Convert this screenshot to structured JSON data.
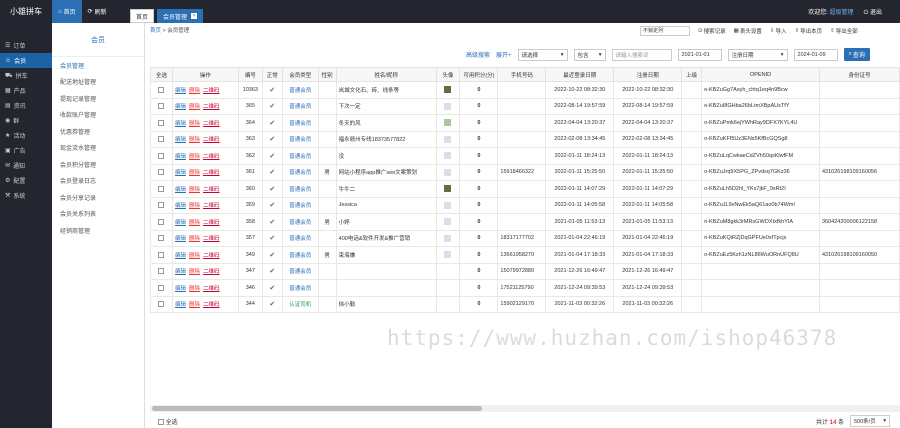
{
  "app": {
    "title": "小雄拼车"
  },
  "topnav": {
    "tabs": [
      {
        "label": "首页",
        "icon": "home-icon"
      },
      {
        "label": "刷新",
        "icon": "refresh-icon"
      }
    ],
    "welcome": "欢迎您:",
    "user": "超级管理",
    "logout": "退出"
  },
  "sidebar": {
    "items": [
      {
        "label": "订单",
        "icon": "order-icon"
      },
      {
        "label": "会员",
        "icon": "user-icon",
        "active": true
      },
      {
        "label": "拼车",
        "icon": "car-icon"
      },
      {
        "label": "产品",
        "icon": "product-icon"
      },
      {
        "label": "资讯",
        "icon": "news-icon"
      },
      {
        "label": "群",
        "icon": "group-icon"
      },
      {
        "label": "活动",
        "icon": "event-icon"
      },
      {
        "label": "广告",
        "icon": "ad-icon"
      },
      {
        "label": "通知",
        "icon": "notice-icon"
      },
      {
        "label": "配置",
        "icon": "config-icon"
      },
      {
        "label": "系统",
        "icon": "system-icon"
      }
    ]
  },
  "window_tabs": [
    {
      "label": "首页"
    },
    {
      "label": "会员管理",
      "active": true
    }
  ],
  "tab_tools": {
    "select": "不锁定列",
    "search_record": "搜索记录",
    "header_settings": "表头设置",
    "import": "导入",
    "export_page": "导出本页",
    "export_all": "导出全部"
  },
  "submenu": {
    "title": "会员",
    "items": [
      "会员管理",
      "配送地址管理",
      "提现记录管理",
      "收款账户管理",
      "优惠券管理",
      "现金流水管理",
      "会员积分管理",
      "会员登录日志",
      "会员分享记录",
      "会员关系列表",
      "经销商管理"
    ]
  },
  "breadcrumb": {
    "home": "首页",
    "sep": " > ",
    "current": "会员管理"
  },
  "filters": {
    "advanced": "高级搜索",
    "expand": "展开+",
    "field_select": "请选择",
    "mode_select": "包含",
    "keyword_placeholder": "请输入搜索词",
    "date_from": "2021-01-01",
    "date_field": "注册日期",
    "date_to": "2024-01-09",
    "search_button": "查询"
  },
  "table": {
    "headers": [
      "全选",
      "操作",
      "编号",
      "正常",
      "会员类型",
      "性别",
      "姓名/昵称",
      "头像",
      "可用积分(分)",
      "手机号码",
      "最近登录日期",
      "注册日期",
      "上级",
      "OPENID",
      "身份证号"
    ],
    "ops": [
      "编辑",
      "删除",
      "二维码"
    ],
    "rows": [
      {
        "id": "10363",
        "type": "普通会员",
        "gender": "",
        "name": "岚城文化石、砖、线条等",
        "avatar": "dark",
        "points": "0",
        "phone": "",
        "last_login": "2022-10-22 08:32:30",
        "reg": "2022-10-22 08:32:30",
        "parent": "",
        "openid": "o-KBZuGg7Asyh_chtq1eq4n9Bcw",
        "idcard": ""
      },
      {
        "id": "365",
        "type": "普通会员",
        "gender": "",
        "name": "下次一定",
        "avatar": "light",
        "points": "0",
        "phone": "",
        "last_login": "2022-08-14 19:57:59",
        "reg": "2022-08-14 19:57:59",
        "parent": "",
        "openid": "o-KBZuI8GHba26bLtmXBpAUsTfY",
        "idcard": ""
      },
      {
        "id": "364",
        "type": "普通会员",
        "gender": "",
        "name": "冬天的风",
        "avatar": "img",
        "points": "0",
        "phone": "",
        "last_login": "2022-04-04 13:20:37",
        "reg": "2022-04-04 13:20:37",
        "parent": "",
        "openid": "o-KBZuPmk6ejYWhRay9DFX7KYL4U",
        "idcard": ""
      },
      {
        "id": "363",
        "type": "普通会员",
        "gender": "",
        "name": "福永赣州专线18373577822",
        "avatar": "light",
        "points": "0",
        "phone": "",
        "last_login": "2022-02-08 13:34:45",
        "reg": "2022-02-08 13:34:45",
        "parent": "",
        "openid": "o-KBZuKFf5Uz3ENs5KfBcGQSg8",
        "idcard": ""
      },
      {
        "id": "362",
        "type": "普通会员",
        "gender": "",
        "name": "没",
        "avatar": "light",
        "points": "0",
        "phone": "",
        "last_login": "2022-01-11 18:24:13",
        "reg": "2022-01-11 18:24:13",
        "parent": "",
        "openid": "o-KBZuLqCwkaeCdZVh50qsKlwfFM",
        "idcard": ""
      },
      {
        "id": "361",
        "type": "普通会员",
        "gender": "男",
        "name": "网站小程序app推广seo文案策划",
        "avatar": "light",
        "points": "0",
        "phone": "15918466322",
        "last_login": "2022-01-11 15:25:50",
        "reg": "2022-01-11 15:25:50",
        "parent": "",
        "openid": "o-KBZuJrq9X5PG_ZPvdsq7GKz36",
        "idcard": "431026198109160056"
      },
      {
        "id": "360",
        "type": "普通会员",
        "gender": "",
        "name": "牛牛二",
        "avatar": "dark",
        "points": "0",
        "phone": "",
        "last_login": "2022-01-11 14:07:29",
        "reg": "2022-01-11 14:07:29",
        "parent": "",
        "openid": "o-KBZuLh5D2hl_YKs7jkF_9sRt2I",
        "idcard": ""
      },
      {
        "id": "359",
        "type": "普通会员",
        "gender": "",
        "name": "Jessica",
        "avatar": "light",
        "points": "0",
        "phone": "",
        "last_login": "2022-01-11 14:05:58",
        "reg": "2022-01-11 14:05:58",
        "parent": "",
        "openid": "o-KBZuJL9vNwEk5aQ61ao0b74WmI",
        "idcard": ""
      },
      {
        "id": "358",
        "type": "普通会员",
        "gender": "男",
        "name": "小婷",
        "avatar": "light",
        "points": "0",
        "phone": "",
        "last_login": "2021-01-05 11:53:13",
        "reg": "2021-01-05 11:53:13",
        "parent": "",
        "openid": "o-KBZuM8gkk3rMRsGWOXtxfkhYIA",
        "idcard": "360424200006122158"
      },
      {
        "id": "357",
        "type": "普通会员",
        "gender": "",
        "name": "400电话&软件开发&推广营销",
        "avatar": "light",
        "points": "0",
        "phone": "18317177702",
        "last_login": "2021-01-04 22:46:19",
        "reg": "2021-01-04 22:46:19",
        "parent": "",
        "openid": "o-KBZuKQiRZjDqGPFUe0xfTpcjs",
        "idcard": ""
      },
      {
        "id": "349",
        "type": "普通会员",
        "gender": "男",
        "name": "束海嫌",
        "avatar": "light",
        "points": "0",
        "phone": "13661958270",
        "last_login": "2021-01-04 17:18:33",
        "reg": "2021-01-04 17:18:33",
        "parent": "",
        "openid": "o-KBZuEz5Kzh1zNL86WuORnUFQ8U",
        "idcard": "431026198109160050"
      },
      {
        "id": "347",
        "type": "普通会员",
        "gender": "",
        "name": "",
        "avatar": "",
        "points": "0",
        "phone": "15079972880",
        "last_login": "2021-12-26 16:49:47",
        "reg": "2021-12-26 16:49:47",
        "parent": "",
        "openid": "",
        "idcard": ""
      },
      {
        "id": "346",
        "type": "普通会员",
        "gender": "",
        "name": "",
        "avatar": "",
        "points": "0",
        "phone": "17521125790",
        "last_login": "2021-12-24 09:39:53",
        "reg": "2021-12-24 09:39:53",
        "parent": "",
        "openid": "",
        "idcard": ""
      },
      {
        "id": "344",
        "type": "认证司机",
        "gender": "",
        "name": "徐小勤",
        "avatar": "",
        "points": "0",
        "phone": "15902129170",
        "last_login": "2021-11-03 00:32:26",
        "reg": "2021-11-03 00:32:26",
        "parent": "",
        "openid": "",
        "idcard": ""
      }
    ]
  },
  "footer": {
    "select_all": "全选",
    "total_prefix": "共计",
    "total": "14",
    "total_suffix": "条",
    "page_size": "500条/页"
  },
  "watermark": "https://www.huzhan.com/ishop46378",
  "colors": {
    "accent": "#2b6fb5",
    "dark_bg": "#23262e",
    "ok": "#1a9a4a",
    "danger": "#e33"
  }
}
